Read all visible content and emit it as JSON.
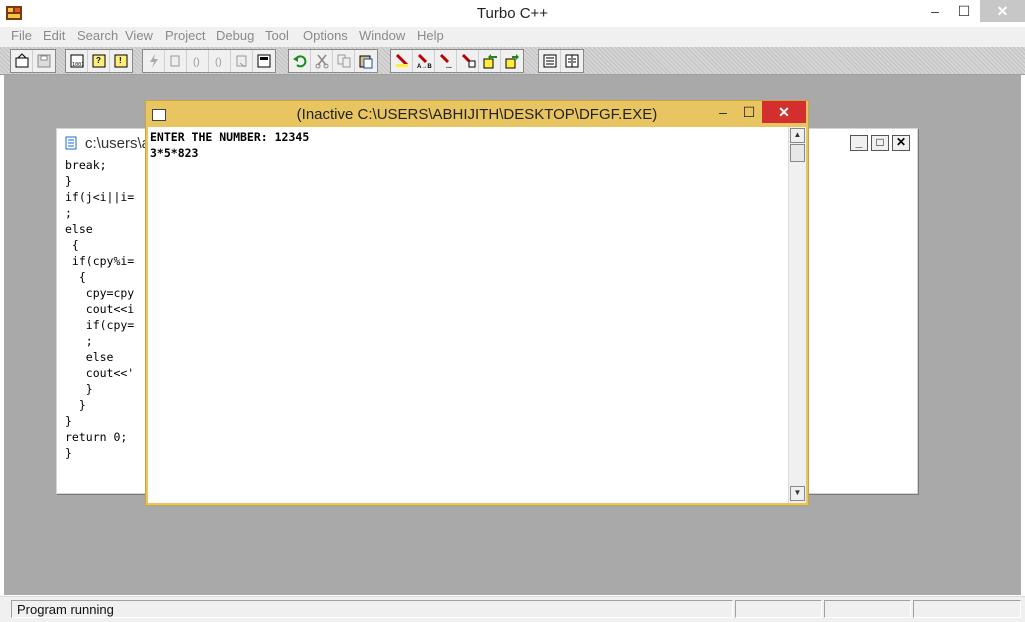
{
  "app": {
    "title": "Turbo C++",
    "controls": {
      "minimize": "–",
      "maximize": "☐",
      "close": "✕"
    }
  },
  "menu": [
    "File",
    "Edit",
    "Search",
    "View",
    "Project",
    "Debug",
    "Tool",
    "Options",
    "Window",
    "Help"
  ],
  "toolbar": {
    "icons": [
      "open-project-icon",
      "save-icon",
      "compile-icon",
      "make-icon",
      "build-all-icon",
      "run-icon",
      "step-over-icon",
      "trace-into-icon",
      "go-to-cursor-icon",
      "toggle-breakpoint-icon",
      "evaluate-icon",
      "undo-icon",
      "cut-icon",
      "copy-icon",
      "paste-icon",
      "find-icon",
      "replace-icon",
      "search-again-icon",
      "browse-icon",
      "previous-icon",
      "next-icon",
      "editor-options-icon",
      "project-options-icon"
    ]
  },
  "editor": {
    "title": "c:\\users\\a",
    "controls": {
      "minimize": "_",
      "maximize": "□",
      "close": "✕"
    },
    "code_lines": [
      "break;",
      "}",
      "if(j<i||i=",
      ";",
      "else",
      " {",
      " if(cpy%i=",
      "  {",
      "   cpy=cpy",
      "   cout<<i",
      "   if(cpy=",
      "   ;",
      "   else",
      "   cout<<'",
      "   }",
      "  }",
      "}",
      "return 0;",
      "}"
    ]
  },
  "console": {
    "title": "(Inactive C:\\USERS\\ABHIJITH\\DESKTOP\\DFGF.EXE)",
    "controls": {
      "minimize": "–",
      "maximize": "☐",
      "close": "✕"
    },
    "output_lines": [
      "ENTER THE NUMBER: 12345",
      "3*5*823"
    ],
    "scroll": {
      "up": "▲",
      "down": "▼"
    }
  },
  "status": {
    "text": "Program running"
  },
  "colors": {
    "workspace": "#a9a9a9",
    "console_border": "#e8c560",
    "close_button": "#d32f2f"
  }
}
